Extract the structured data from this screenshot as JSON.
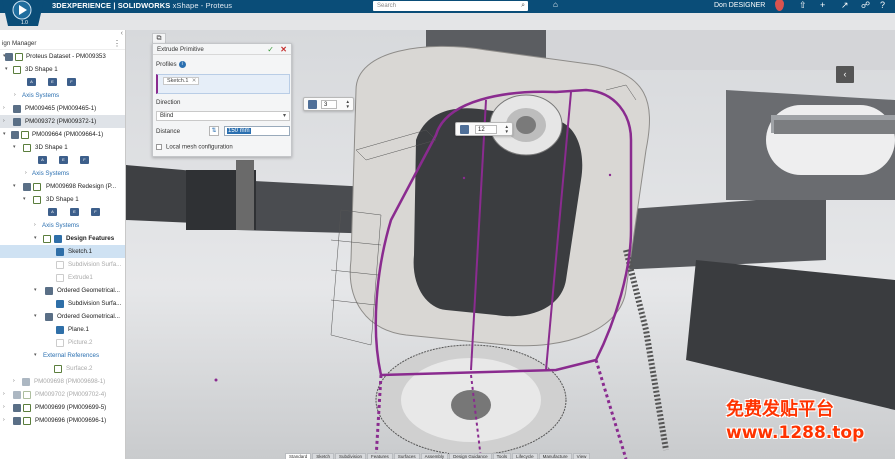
{
  "header": {
    "brand_prefix": "3DEXPERIENCE | SOLIDWORKS",
    "brand_app": "xShape - Proteus",
    "search_placeholder": "Search",
    "user": "Don DESIGNER",
    "compass_label": "1.0",
    "accent": "#0a4d78"
  },
  "tree": {
    "title": "ign Manager",
    "rows": [
      {
        "label": "Proteus Dataset - PM009353"
      },
      {
        "label": "3D Shape 1"
      },
      {
        "label": "Axis Systems"
      },
      {
        "label": "PM009465 (PM009465-1)"
      },
      {
        "label": "PM009372 (PM009372-1)"
      },
      {
        "label": "PM009664 (PM009664-1)"
      },
      {
        "label": "3D Shape 1"
      },
      {
        "label": "Axis Systems"
      },
      {
        "label": "PM009698 Redesign (P..."
      },
      {
        "label": "3D Shape 1"
      },
      {
        "label": "Axis Systems"
      },
      {
        "label": "Design Features"
      },
      {
        "label": "Sketch.1"
      },
      {
        "label": "Subdivision Surfa..."
      },
      {
        "label": "Extrude1"
      },
      {
        "label": "Ordered Geometrical..."
      },
      {
        "label": "Subdivision Surfa..."
      },
      {
        "label": "Ordered Geometrical..."
      },
      {
        "label": "Plane.1"
      },
      {
        "label": "Picture.2"
      },
      {
        "label": "External References"
      },
      {
        "label": "Surface.2"
      },
      {
        "label": "PM009698 (PM009698-1)"
      },
      {
        "label": "PM009702 (PM009702-4)"
      },
      {
        "label": "PM009699 (PM009699-5)"
      },
      {
        "label": "PM009696 (PM009696-1)"
      }
    ],
    "shape_badges": [
      "A",
      "E",
      "F"
    ]
  },
  "extrude_panel": {
    "title": "Extrude Primitive",
    "profiles_label": "Profiles",
    "profile_chip": "Sketch.1",
    "direction_label": "Direction",
    "direction_value": "Blind",
    "distance_label": "Distance",
    "distance_value": "150 mm",
    "local_mesh_label": "Local mesh configuration",
    "profile_color": "#8a2b8f"
  },
  "spinners": {
    "top": "3",
    "mid": "12"
  },
  "bottom_tabs": [
    "Standard",
    "Sketch",
    "Subdivision",
    "Features",
    "Surfaces",
    "Assembly",
    "Design Guidance",
    "Tools",
    "Lifecycle",
    "Manufacture",
    "View"
  ],
  "watermark": {
    "line1": "免费发贴平台",
    "line2": "www.1288.top",
    "color": "#ff3300"
  }
}
